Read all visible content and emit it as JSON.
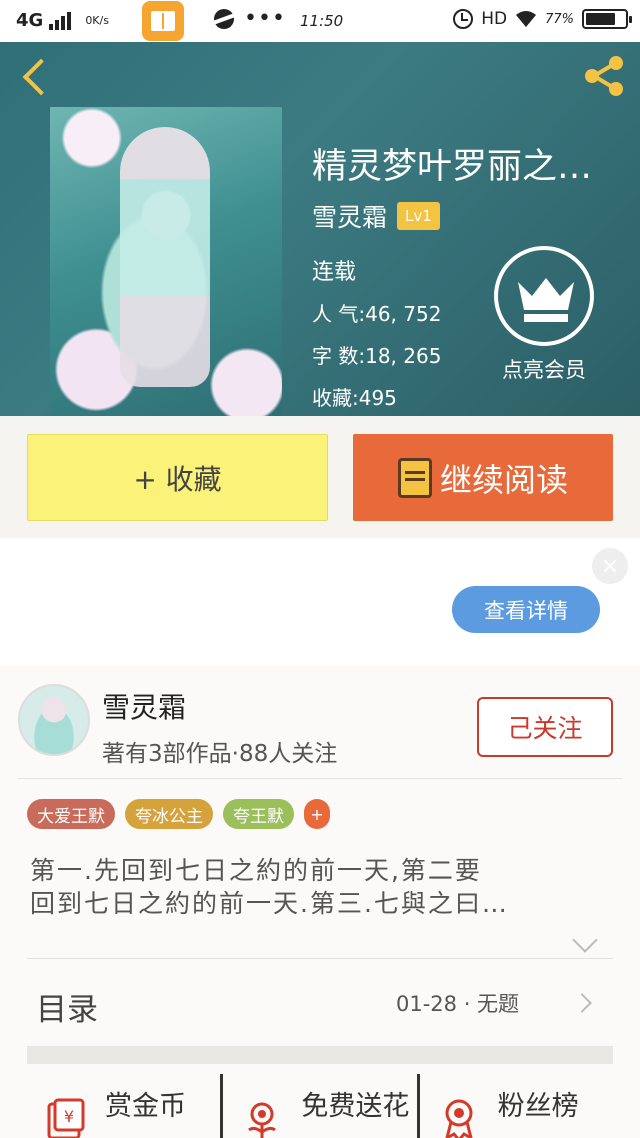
{
  "status_bar": {
    "network": "4G",
    "speed": "0K/s",
    "time": "11:50",
    "hd": "HD",
    "battery_pct": "77%"
  },
  "book": {
    "title": "精灵梦叶罗丽之…",
    "author": "雪灵霜",
    "level_badge": "Lv1",
    "status": "连载",
    "popularity": "人 气:46, 752",
    "word_count": "字 数:18, 265",
    "favorites": "收藏:495"
  },
  "vip": {
    "label": "点亮会员"
  },
  "actions": {
    "collect_label": "+ 收藏",
    "read_label": "继续阅读"
  },
  "ad": {
    "detail_label": "查看详情"
  },
  "author_card": {
    "name": "雪灵霜",
    "meta": "著有3部作品·88人关注",
    "follow_label": "己关注"
  },
  "tags": [
    {
      "label": "大爱王默",
      "color": "#c96b5a"
    },
    {
      "label": "夸冰公主",
      "color": "#d6a23c"
    },
    {
      "label": "夸王默",
      "color": "#9bbf5b"
    }
  ],
  "tags_more": "+",
  "intro": {
    "line1": "第一.先回到七日之約的前一天,第二要",
    "line2": "回到七日之約的前一天.第三.七與之曰…"
  },
  "toc": {
    "label": "目录",
    "chapter": "01-28 · 无题"
  },
  "tools": [
    {
      "label": "赏金币",
      "icon": "gold-coin-icon"
    },
    {
      "label": "免费送花",
      "icon": "flower-icon"
    },
    {
      "label": "粉丝榜",
      "icon": "medal-icon"
    }
  ],
  "colors": {
    "header_bg": "#3c7b82",
    "accent_yellow": "#f5c342",
    "read_button": "#e8693a",
    "collect_button": "#fbf27a",
    "follow_red": "#c93a2a",
    "detail_blue": "#5c9bdf"
  }
}
